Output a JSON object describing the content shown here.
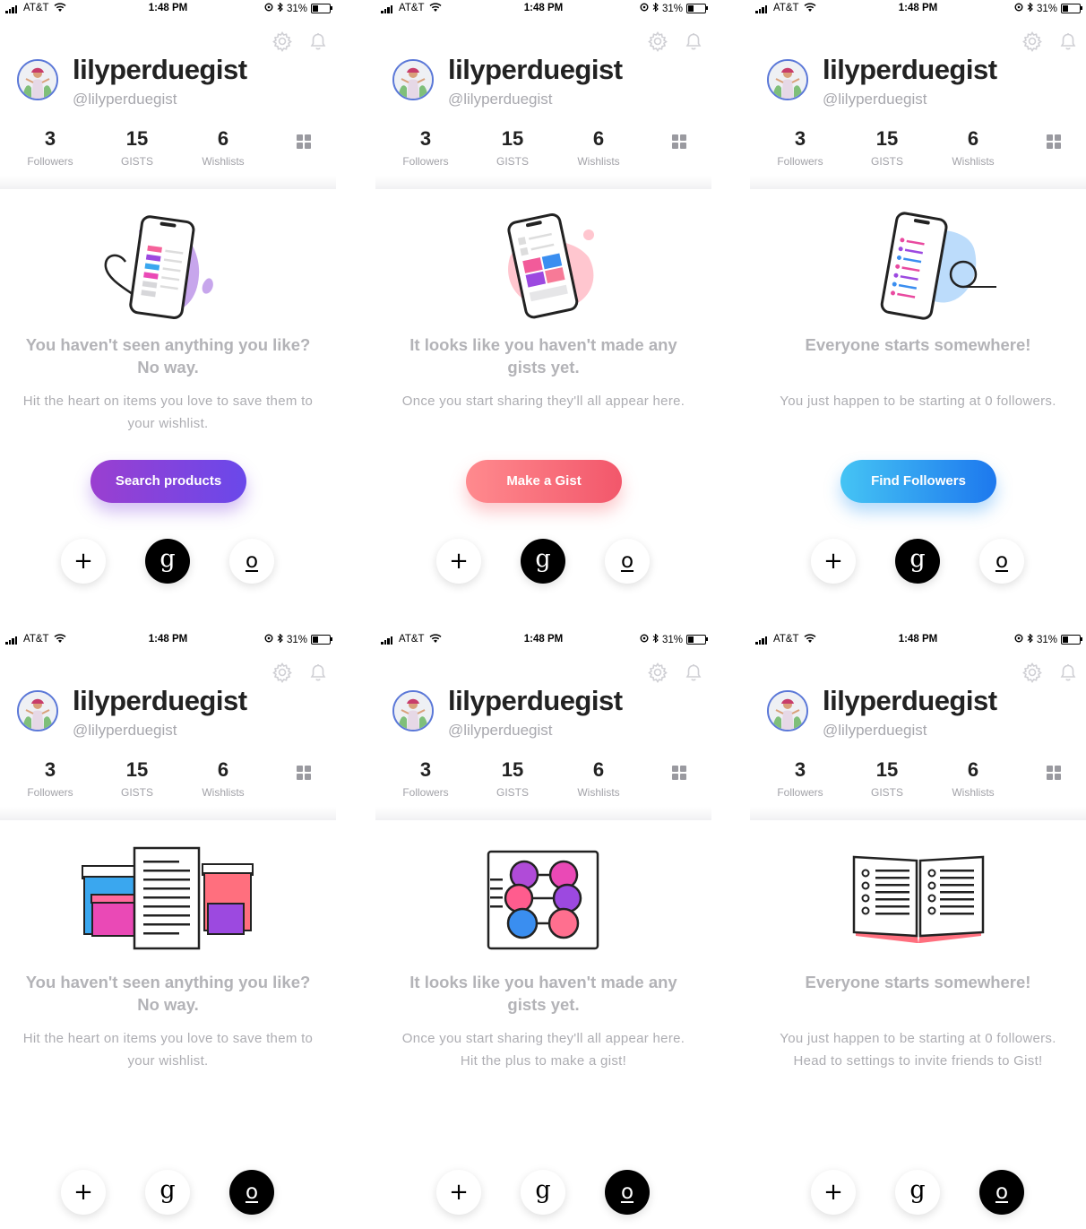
{
  "status_bar": {
    "carrier": "AT&T",
    "time": "1:48 PM",
    "battery": "31%"
  },
  "profile": {
    "name": "lilyperduegist",
    "handle": "@lilyperduegist",
    "stats": [
      {
        "value": "3",
        "label": "Followers"
      },
      {
        "value": "15",
        "label": "GISTS"
      },
      {
        "value": "6",
        "label": "Wishlists"
      }
    ]
  },
  "screens": [
    {
      "heading": "You haven't seen anything you like? No way.",
      "sub": "Hit the heart on items you love to save them to your wishlist.",
      "button": "Search products"
    },
    {
      "heading": "It looks like you haven't made any gists yet.",
      "sub": "Once you start sharing they'll all appear here.",
      "button": "Make a Gist"
    },
    {
      "heading": "Everyone starts somewhere!",
      "sub": "You just happen to be starting at 0 followers.",
      "button": "Find Followers"
    },
    {
      "heading": "You haven't seen anything you like? No way.",
      "sub": "Hit the heart on items you love to save them to your wishlist."
    },
    {
      "heading": "It looks like you haven't made any gists yet.",
      "sub": "Once you start sharing they'll all appear here. Hit the plus to make a gist!"
    },
    {
      "heading": "Everyone starts somewhere!",
      "sub": "You just happen to be starting at 0 followers. Head to settings to invite friends to Gist!"
    }
  ],
  "nav": {
    "add": "+",
    "gist": "g",
    "profile": "o"
  },
  "colors": {
    "purple_button": "#7f44de",
    "coral_button": "#f2576b",
    "blue_button": "#1d78ee",
    "text_dark": "#222222",
    "text_muted": "#adadb2"
  }
}
